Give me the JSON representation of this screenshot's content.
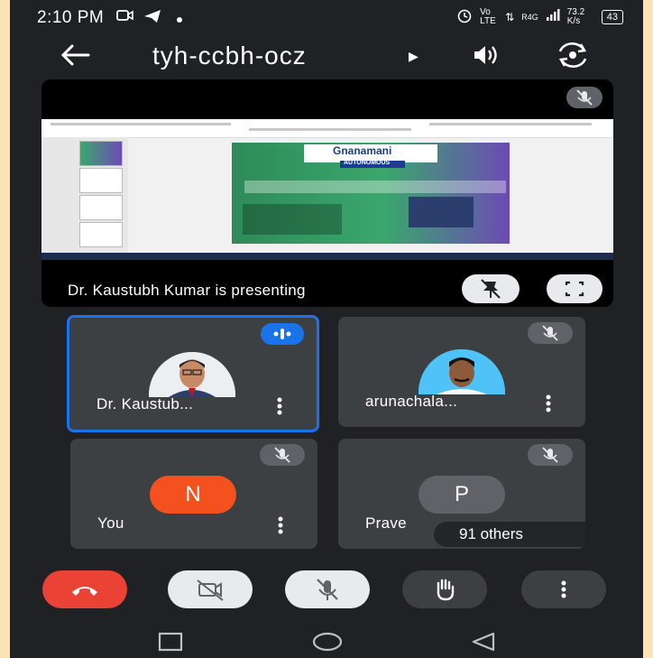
{
  "status_bar": {
    "time": "2:10 PM",
    "network_speed": "73.2 K/s",
    "battery": "43",
    "net_labels": "Vo LTE",
    "signal_label": "R4G"
  },
  "meeting": {
    "code": "tyh-ccbh-ocz"
  },
  "presentation": {
    "caption": "Dr. Kaustubh Kumar is presenting",
    "slide": {
      "org_name": "Gnanamani",
      "org_tag": "AUTONOMOUS"
    }
  },
  "participants": [
    {
      "name": "Dr. Kaustub...",
      "state": "speaking"
    },
    {
      "name": "arunachala...",
      "state": "muted"
    },
    {
      "name": "You",
      "initial": "N",
      "avatar_color": "#f4511e",
      "state": "muted"
    },
    {
      "name": "Prave",
      "initial": "P",
      "avatar_color": "#5f6368",
      "state": "muted"
    }
  ],
  "others_count": "91 others",
  "colors": {
    "accent": "#1a73e8",
    "end_call": "#ea4335",
    "background_frame": "#fbe3b4"
  },
  "controls": [
    {
      "icon": "end-call-icon"
    },
    {
      "icon": "camera-off-icon"
    },
    {
      "icon": "mic-off-icon"
    },
    {
      "icon": "raise-hand-icon"
    },
    {
      "icon": "more-options-icon"
    }
  ],
  "nav_bar": [
    "recent-apps-icon",
    "home-icon",
    "back-nav-icon"
  ]
}
